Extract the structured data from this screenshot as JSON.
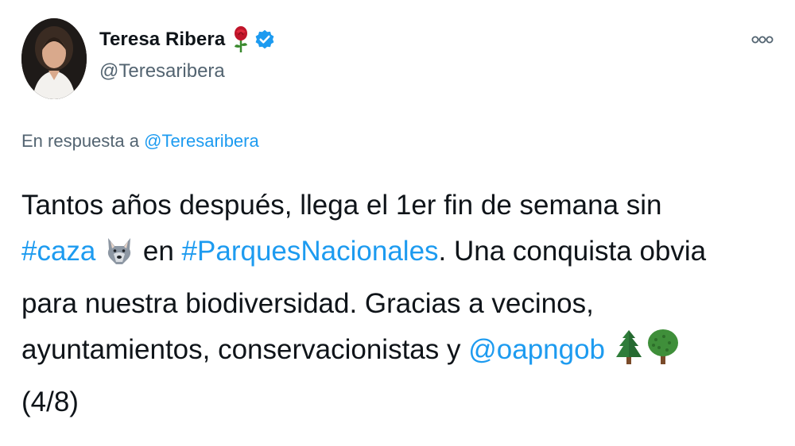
{
  "author": {
    "display_name": "Teresa Ribera",
    "handle": "@Teresaribera",
    "badges": [
      "rose-icon",
      "verified-icon"
    ],
    "verified_color": "#1d9bf0"
  },
  "reply": {
    "prefix": "En respuesta a",
    "mention": "@Teresaribera"
  },
  "tweet": {
    "line1": "Tantos años después, llega el 1er fin de semana  sin",
    "hashtag_caza": "#caza",
    "emoji_wolf": "wolf-icon",
    "word_en": "en",
    "hashtag_parques": "#ParquesNacionales",
    "line2_rest": ". Una conquista obvia",
    "line3": "para nuestra biodiversidad. Gracias a vecinos,",
    "line4": "ayuntamientos, conservacionistas y",
    "mention_oapn": "@oapngob",
    "emoji_trees": [
      "evergreen-tree-icon",
      "deciduous-tree-icon"
    ],
    "counter": "(4/8)"
  },
  "colors": {
    "link": "#1d9bf0",
    "secondary_text": "#536471",
    "primary_text": "#0f1419"
  }
}
